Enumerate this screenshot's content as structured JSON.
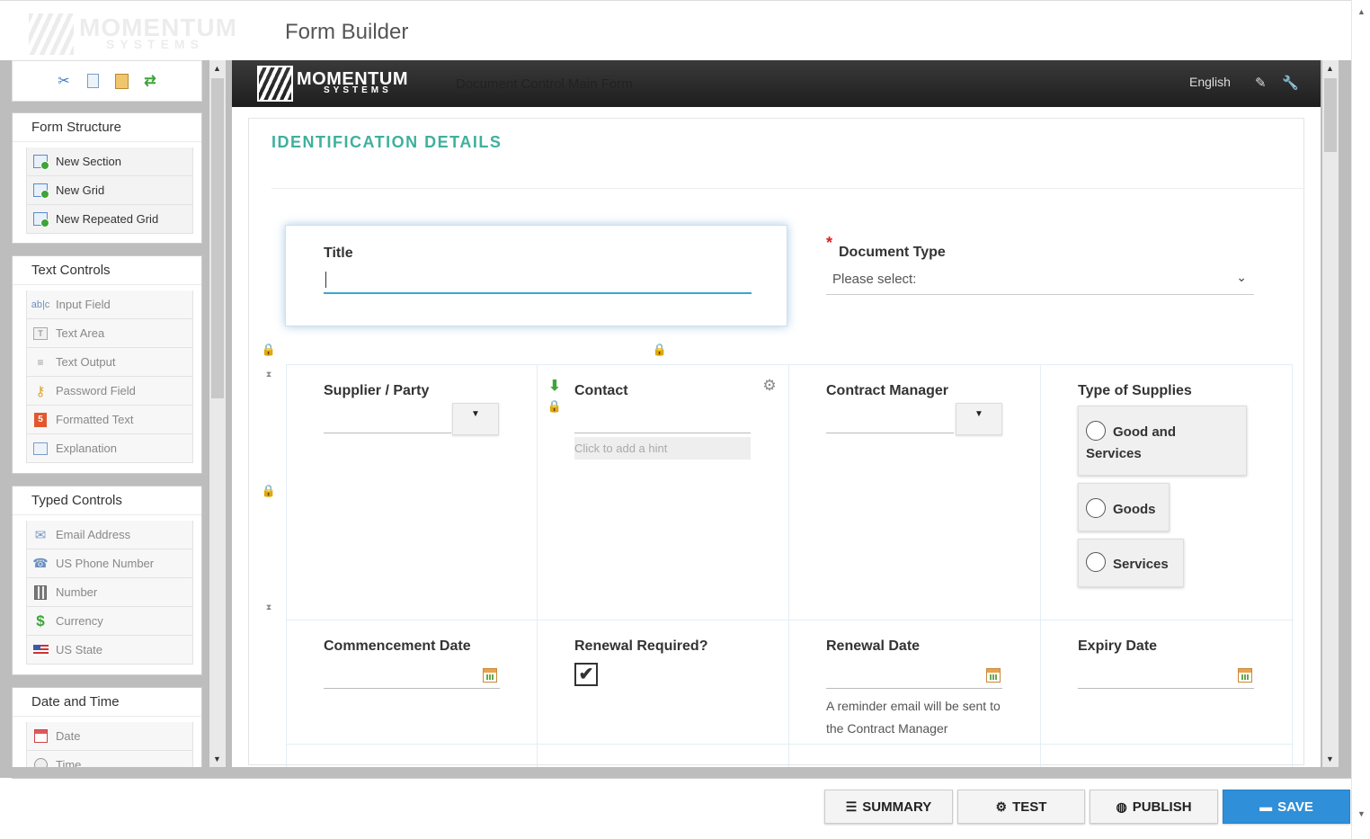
{
  "header": {
    "logo_word": "MOMENTUM",
    "logo_sub": "SYSTEMS",
    "app_title": "Form Builder"
  },
  "palette": {
    "toolbar": [
      "cut-icon",
      "copy-icon",
      "paste-icon",
      "refresh-icon"
    ],
    "groups": [
      {
        "title": "Form Structure",
        "items": [
          {
            "label": "New Section",
            "icon": "section-add-icon",
            "enabled": true
          },
          {
            "label": "New Grid",
            "icon": "grid-add-icon",
            "enabled": true
          },
          {
            "label": "New Repeated Grid",
            "icon": "repeated-grid-add-icon",
            "enabled": true
          }
        ]
      },
      {
        "title": "Text Controls",
        "items": [
          {
            "label": "Input Field",
            "icon": "input-field-icon",
            "enabled": false
          },
          {
            "label": "Text Area",
            "icon": "text-area-icon",
            "enabled": false
          },
          {
            "label": "Text Output",
            "icon": "text-output-icon",
            "enabled": false
          },
          {
            "label": "Password Field",
            "icon": "key-icon",
            "enabled": false
          },
          {
            "label": "Formatted Text",
            "icon": "html5-icon",
            "enabled": false
          },
          {
            "label": "Explanation",
            "icon": "explanation-icon",
            "enabled": false
          }
        ]
      },
      {
        "title": "Typed Controls",
        "items": [
          {
            "label": "Email Address",
            "icon": "envelope-icon",
            "enabled": false
          },
          {
            "label": "US Phone Number",
            "icon": "phone-icon",
            "enabled": false
          },
          {
            "label": "Number",
            "icon": "calculator-icon",
            "enabled": false
          },
          {
            "label": "Currency",
            "icon": "dollar-icon",
            "enabled": false
          },
          {
            "label": "US State",
            "icon": "us-flag-icon",
            "enabled": false
          }
        ]
      },
      {
        "title": "Date and Time",
        "items": [
          {
            "label": "Date",
            "icon": "calendar-icon",
            "enabled": false
          },
          {
            "label": "Time",
            "icon": "clock-icon",
            "enabled": false
          }
        ]
      }
    ]
  },
  "form": {
    "header_logo_word": "MOMENTUM",
    "header_logo_sub": "SYSTEMS",
    "header_title": "Document Control Main Form",
    "language": "English",
    "section_title": "IDENTIFICATION DETAILS",
    "title_label": "Title",
    "title_value": "",
    "document_type_label": "Document Type",
    "document_type_required": "*",
    "document_type_placeholder": "Please select:",
    "supplier_label": "Supplier / Party",
    "contact_label": "Contact",
    "contact_hint": "Click to add a hint",
    "contract_manager_label": "Contract Manager",
    "type_of_supplies_label": "Type of Supplies",
    "supply_options": [
      "Good and Services",
      "Goods",
      "Services"
    ],
    "supply_option_line1": "Good and",
    "supply_option_line2": "Services",
    "commencement_label": "Commencement Date",
    "renewal_required_label": "Renewal Required?",
    "renewal_required_checked": true,
    "renewal_date_label": "Renewal Date",
    "renewal_help_line1": "A reminder email will be sent to",
    "renewal_help_line2": "the Contract Manager",
    "expiry_label": "Expiry Date"
  },
  "footer": {
    "summary": "SUMMARY",
    "test": "TEST",
    "publish": "PUBLISH",
    "save": "SAVE"
  },
  "colors": {
    "section_title": "#3fb09d",
    "save_button": "#2f8fd8",
    "required_star": "#d92020",
    "focus_underline": "#3aa8c9"
  }
}
